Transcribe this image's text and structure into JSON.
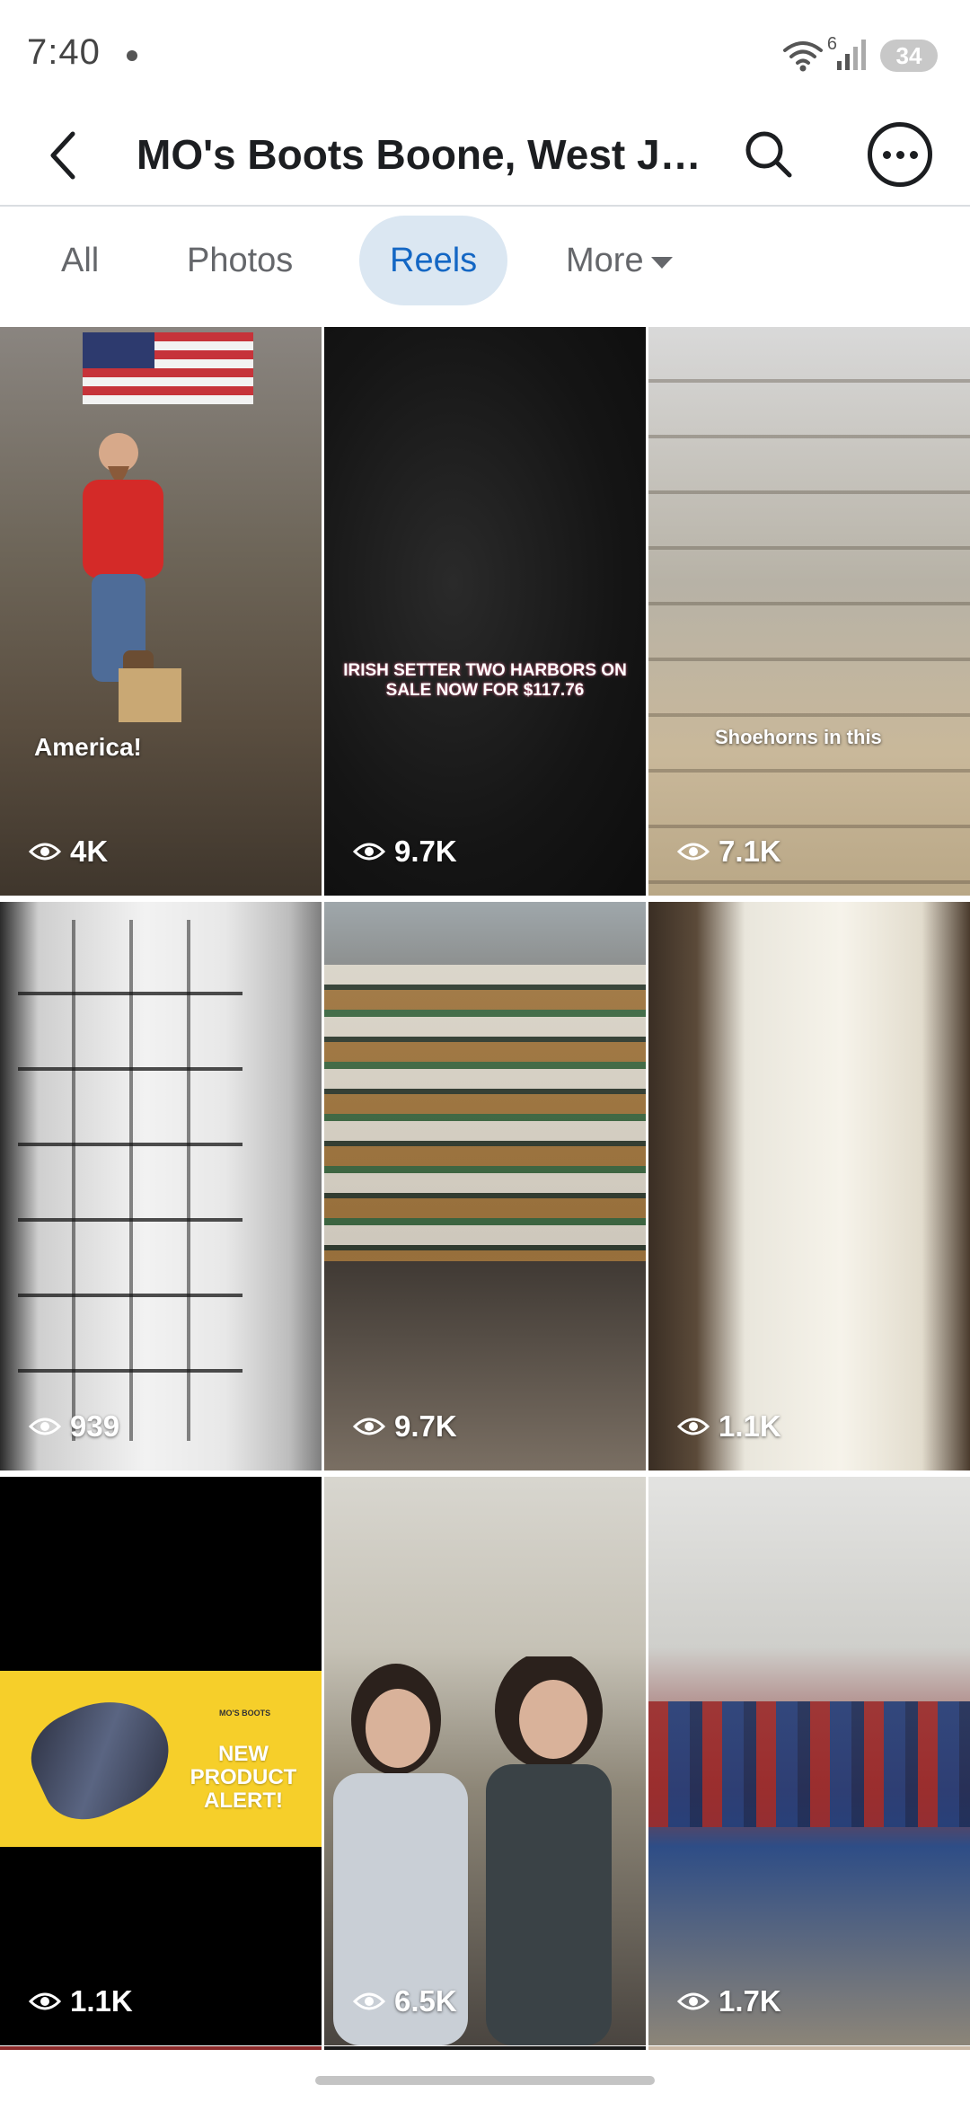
{
  "status_bar": {
    "time": "7:40",
    "wifi_label": "6",
    "battery": "34"
  },
  "header": {
    "title": "MO's Boots Boone, West Je..."
  },
  "tabs": [
    {
      "label": "All",
      "active": false
    },
    {
      "label": "Photos",
      "active": false
    },
    {
      "label": "Reels",
      "active": true
    },
    {
      "label": "More",
      "active": false
    }
  ],
  "reels": [
    {
      "views": "4K",
      "caption": "America!"
    },
    {
      "views": "9.7K",
      "caption": "IRISH SETTER TWO HARBORS ON SALE NOW FOR $117.76"
    },
    {
      "views": "7.1K",
      "caption": "Shoehorns in this"
    },
    {
      "views": "939",
      "caption": ""
    },
    {
      "views": "9.7K",
      "caption": ""
    },
    {
      "views": "1.1K",
      "caption": ""
    },
    {
      "views": "1.1K",
      "caption": "NEW PRODUCT ALERT!",
      "brand": "MO'S BOOTS"
    },
    {
      "views": "6.5K",
      "caption": ""
    },
    {
      "views": "1.7K",
      "caption": ""
    }
  ],
  "colors": {
    "accent": "#1467c4",
    "active_tab_bg": "#dbe7f2",
    "inactive_tab_text": "#65676b",
    "promo_yellow": "#f6cf2a"
  },
  "icons": [
    "back-arrow-icon",
    "search-icon",
    "more-options-icon",
    "eye-icon",
    "wifi-icon",
    "signal-icon",
    "battery-icon",
    "caret-down-icon"
  ]
}
